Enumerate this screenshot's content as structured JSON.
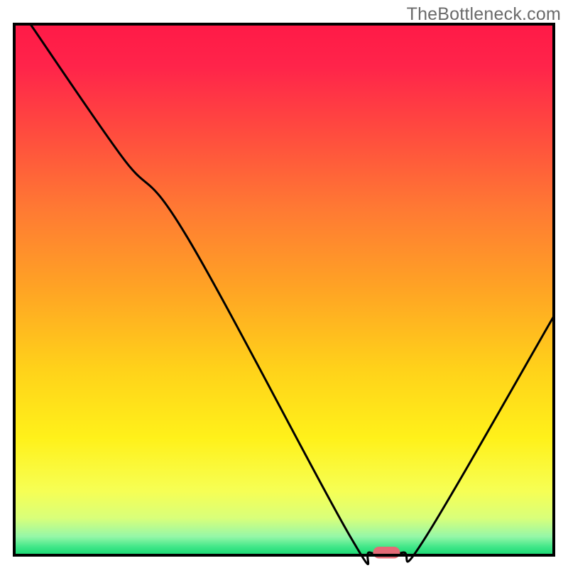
{
  "watermark": "TheBottleneck.com",
  "chart_data": {
    "type": "line",
    "title": "",
    "xlabel": "",
    "ylabel": "",
    "xlim": [
      0,
      100
    ],
    "ylim": [
      0,
      100
    ],
    "curve": [
      {
        "x": 3,
        "y": 100
      },
      {
        "x": 20,
        "y": 75
      },
      {
        "x": 32,
        "y": 60
      },
      {
        "x": 62,
        "y": 4
      },
      {
        "x": 66,
        "y": 0.5
      },
      {
        "x": 72,
        "y": 0.5
      },
      {
        "x": 76,
        "y": 3
      },
      {
        "x": 100,
        "y": 45
      }
    ],
    "marker": {
      "x": 69,
      "y": 0.5,
      "color": "#e46a76",
      "w": 5,
      "h": 2.2
    },
    "gradient_stops": [
      {
        "offset": 0.0,
        "color": "#ff1a47"
      },
      {
        "offset": 0.08,
        "color": "#ff244a"
      },
      {
        "offset": 0.2,
        "color": "#ff4a3f"
      },
      {
        "offset": 0.35,
        "color": "#ff7a33"
      },
      {
        "offset": 0.5,
        "color": "#ffa424"
      },
      {
        "offset": 0.65,
        "color": "#ffd21a"
      },
      {
        "offset": 0.78,
        "color": "#fff11a"
      },
      {
        "offset": 0.88,
        "color": "#f6ff55"
      },
      {
        "offset": 0.93,
        "color": "#d9ff7a"
      },
      {
        "offset": 0.965,
        "color": "#95f7a8"
      },
      {
        "offset": 0.985,
        "color": "#3ee687"
      },
      {
        "offset": 1.0,
        "color": "#19d873"
      }
    ],
    "frame_color": "#000000",
    "frame_width": 4,
    "curve_color": "#000000",
    "curve_width": 3
  }
}
